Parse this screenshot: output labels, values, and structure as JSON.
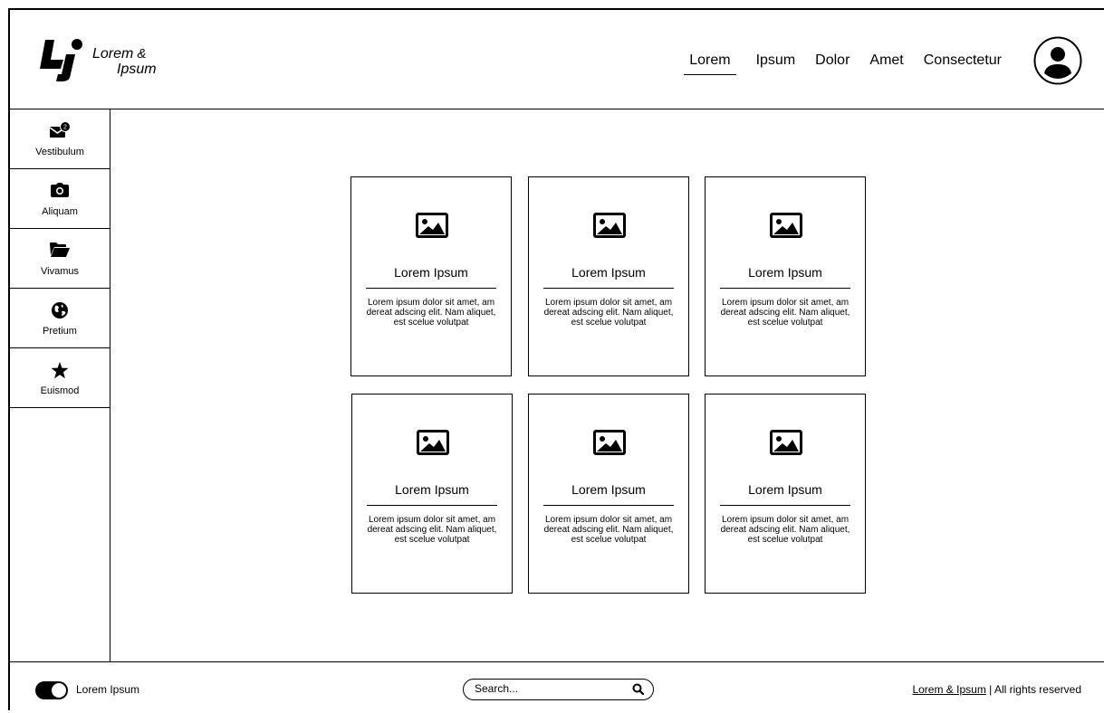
{
  "brand": {
    "line1": "Lorem",
    "amp": "&",
    "line2": "Ipsum"
  },
  "nav": {
    "items": [
      {
        "label": "Lorem",
        "active": true
      },
      {
        "label": "Ipsum"
      },
      {
        "label": "Dolor"
      },
      {
        "label": "Amet"
      },
      {
        "label": "Consectetur"
      }
    ]
  },
  "sidebar": {
    "items": [
      {
        "label": "Vestibulum",
        "icon": "mail-icon",
        "badge": "2"
      },
      {
        "label": "Aliquam",
        "icon": "camera-icon"
      },
      {
        "label": "Vivamus",
        "icon": "folder-icon"
      },
      {
        "label": "Pretium",
        "icon": "globe-icon"
      },
      {
        "label": "Euismod",
        "icon": "star-icon"
      }
    ]
  },
  "cards": [
    {
      "title": "Lorem Ipsum",
      "text": "Lorem ipsum dolor sit amet, am dereat adscing elit. Nam aliquet, est scelue volutpat"
    },
    {
      "title": "Lorem Ipsum",
      "text": "Lorem ipsum dolor sit amet, am dereat adscing elit. Nam aliquet, est scelue volutpat"
    },
    {
      "title": "Lorem Ipsum",
      "text": "Lorem ipsum dolor sit amet, am dereat adscing elit. Nam aliquet, est scelue volutpat"
    },
    {
      "title": "Lorem Ipsum",
      "text": "Lorem ipsum dolor sit amet, am dereat adscing elit. Nam aliquet, est scelue volutpat"
    },
    {
      "title": "Lorem Ipsum",
      "text": "Lorem ipsum dolor sit amet, am dereat adscing elit. Nam aliquet, est scelue volutpat"
    },
    {
      "title": "Lorem Ipsum",
      "text": "Lorem ipsum dolor sit amet, am dereat adscing elit. Nam aliquet, est scelue volutpat"
    }
  ],
  "footer": {
    "toggle_label": "Lorem Ipsum",
    "toggle_on": true,
    "search_placeholder": "Search...",
    "copyright_link": "Lorem & Ipsum",
    "copyright_text": " | All rights reserved"
  }
}
